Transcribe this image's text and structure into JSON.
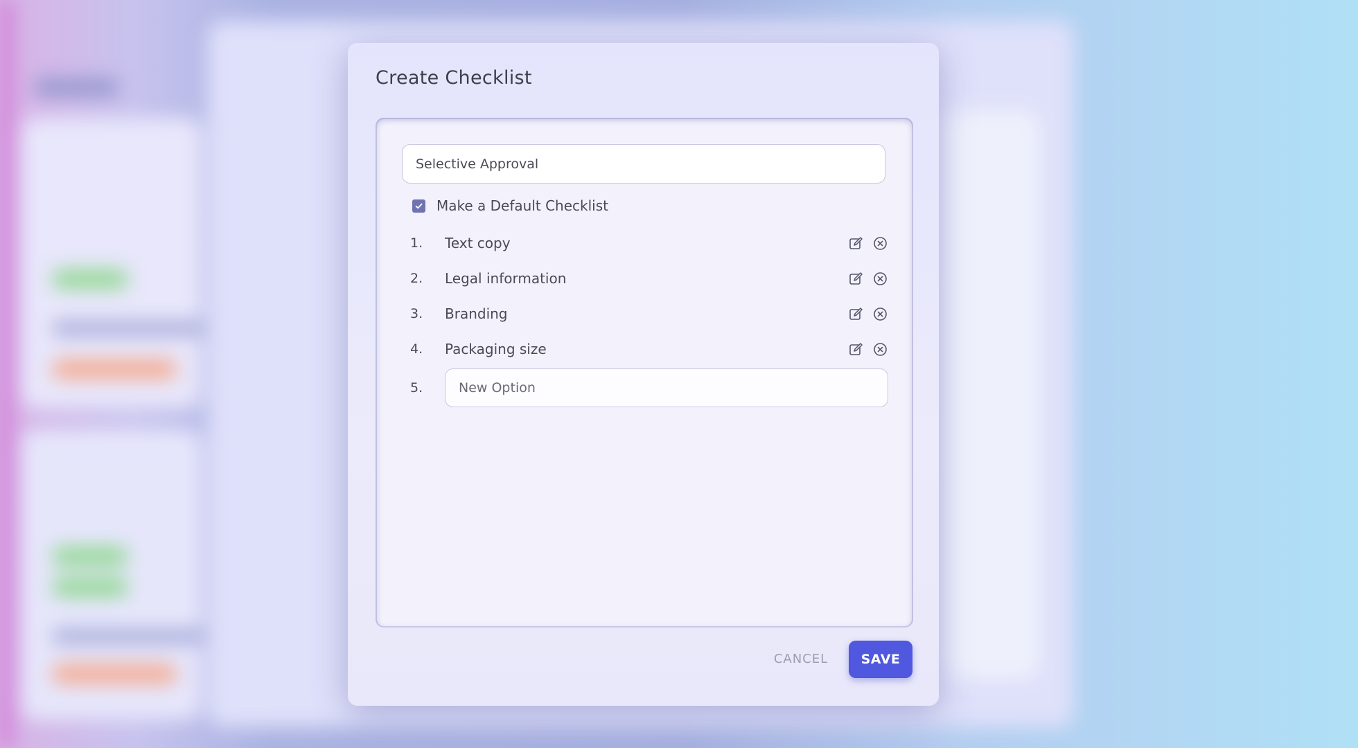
{
  "modal": {
    "title": "Create Checklist",
    "name_value": "Selective Approval",
    "default_checkbox": {
      "label": "Make a Default Checklist",
      "checked": true
    },
    "items": [
      {
        "number": "1.",
        "text": "Text copy"
      },
      {
        "number": "2.",
        "text": "Legal information"
      },
      {
        "number": "3.",
        "text": "Branding"
      },
      {
        "number": "4.",
        "text": "Packaging size"
      }
    ],
    "new_item": {
      "number": "5.",
      "placeholder": "New Option"
    },
    "buttons": {
      "cancel": "CANCEL",
      "save": "SAVE"
    }
  },
  "icons": {
    "edit": "edit-icon",
    "remove": "remove-circle-x-icon",
    "check": "checkmark-icon"
  },
  "colors": {
    "save_button": "#4f58de",
    "checkbox": "#6f73b0",
    "modal_bg": "#e6e6fb"
  }
}
